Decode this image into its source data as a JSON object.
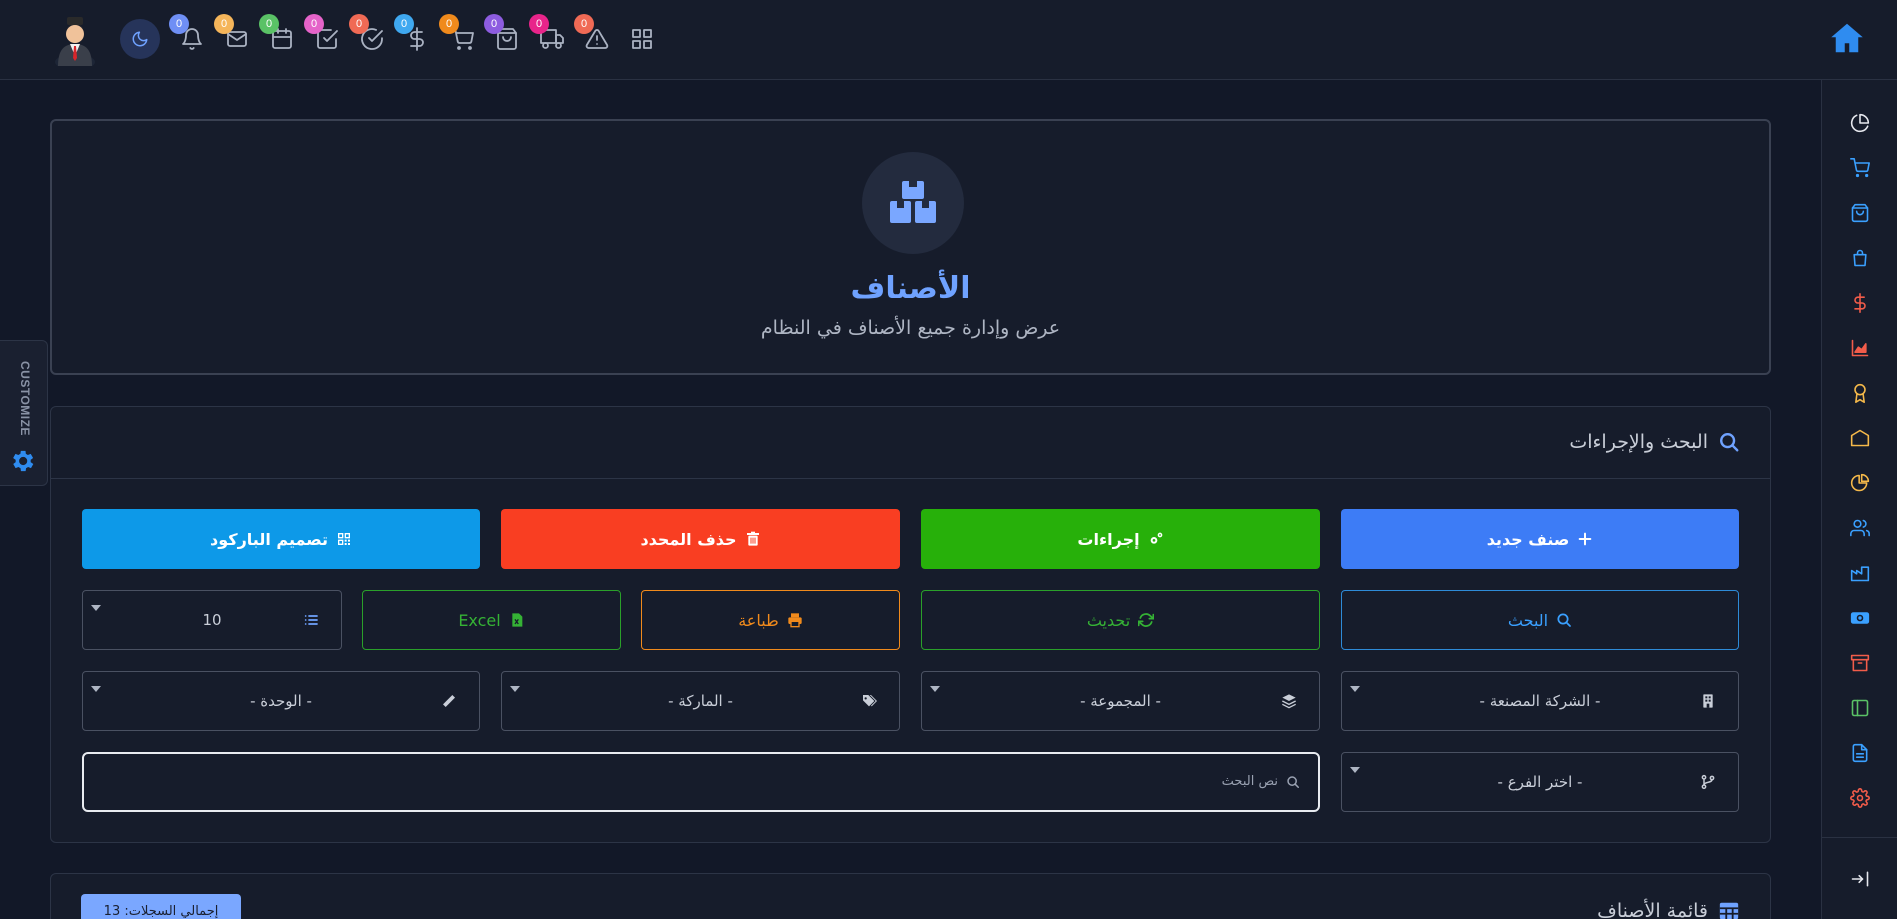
{
  "topbar": {
    "badges": [
      {
        "name": "notifications",
        "icon": "bell-icon",
        "count": "0",
        "color": "#6f8ff5"
      },
      {
        "name": "messages",
        "icon": "mail-icon",
        "count": "0",
        "color": "#f5b55a"
      },
      {
        "name": "calendar",
        "icon": "calendar-icon",
        "count": "0",
        "color": "#5ac266"
      },
      {
        "name": "tasks",
        "icon": "checkbox-icon",
        "count": "0",
        "color": "#e563c9"
      },
      {
        "name": "approvals",
        "icon": "check-circle-icon",
        "count": "0",
        "color": "#f06a55"
      },
      {
        "name": "payments",
        "icon": "dollar-icon",
        "count": "0",
        "color": "#3fa8f0"
      },
      {
        "name": "cart",
        "icon": "cart-icon",
        "count": "0",
        "color": "#f08a1c"
      },
      {
        "name": "shopping-bag",
        "icon": "bag-icon",
        "count": "0",
        "color": "#8d5ce0"
      },
      {
        "name": "shipping",
        "icon": "truck-icon",
        "count": "0",
        "color": "#e8248a"
      },
      {
        "name": "alerts",
        "icon": "warning-icon",
        "count": "0",
        "color": "#f06a55"
      }
    ]
  },
  "hero": {
    "title": "الأصناف",
    "subtitle": "عرض وإدارة جميع الأصناف في النظام"
  },
  "customize": {
    "label": "CUSTOMIZE"
  },
  "search_section": {
    "title": "البحث والإجراءات",
    "buttons": {
      "new_item": "صنف جديد",
      "actions": "إجراءات",
      "delete_selected": "حذف المحدد",
      "barcode_design": "تصميم الباركود",
      "search": "البحث",
      "refresh": "تحديث",
      "print": "طباعة",
      "excel": "Excel"
    },
    "page_size": "10",
    "filters": {
      "manufacturer": "- الشركة المصنعة -",
      "group": "- المجموعة -",
      "brand": "- الماركة -",
      "unit": "- الوحدة -",
      "branch": "- اختر الفرع -"
    },
    "search_placeholder": "نص البحث"
  },
  "list_section": {
    "title": "قائمة الأصناف",
    "total": "إجمالي السجلات: 13"
  },
  "colors": {
    "primary": "#3d7cf6",
    "success": "#27b00a",
    "danger": "#f93e22",
    "info": "#0d99e8",
    "outline_primary": "#2e8bd8",
    "outline_success": "#2aa02a",
    "outline_warning": "#f08a1c"
  }
}
